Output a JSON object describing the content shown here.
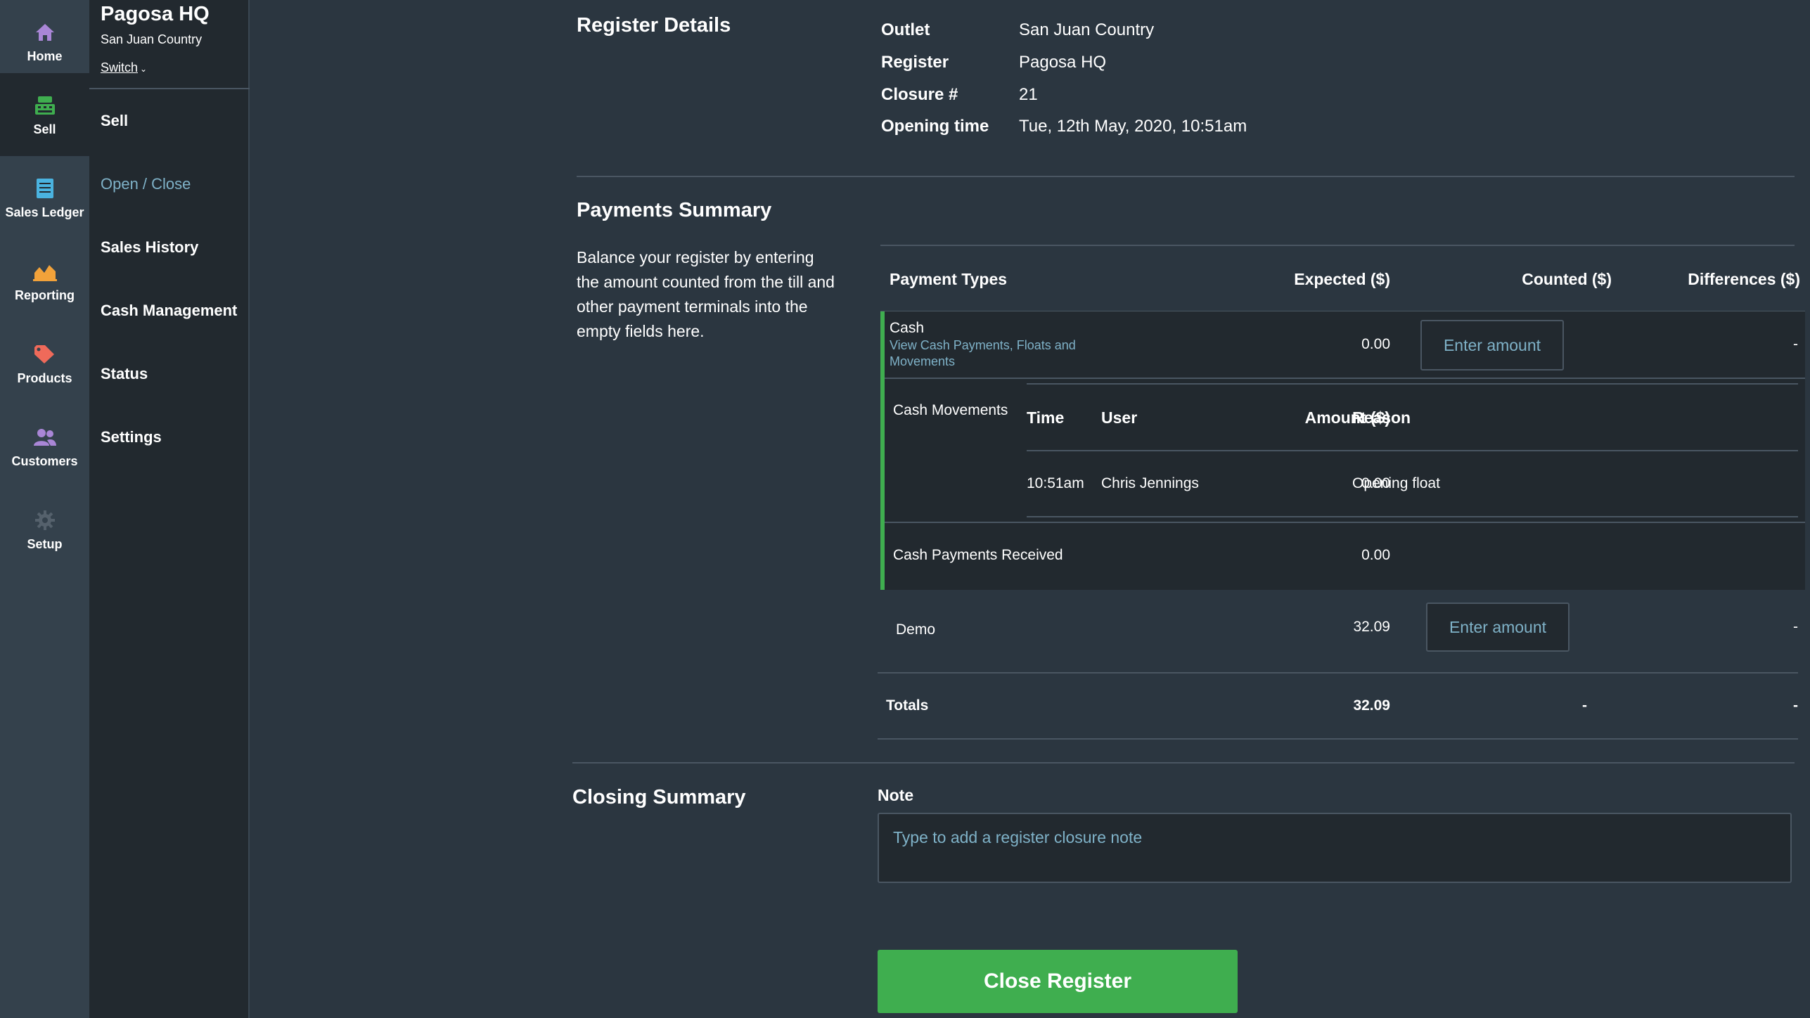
{
  "rail": [
    {
      "label": "Home",
      "icon": "home-icon",
      "color": "#a986d6"
    },
    {
      "label": "Sell",
      "icon": "register-icon",
      "color": "#3fae4f"
    },
    {
      "label": "Sales Ledger",
      "icon": "ledger-icon",
      "color": "#4ab3e0"
    },
    {
      "label": "Reporting",
      "icon": "chart-icon",
      "color": "#f2a23a"
    },
    {
      "label": "Products",
      "icon": "tag-icon",
      "color": "#ef6a5a"
    },
    {
      "label": "Customers",
      "icon": "users-icon",
      "color": "#a986d6"
    },
    {
      "label": "Setup",
      "icon": "gear-icon",
      "color": "#55616c"
    }
  ],
  "store": {
    "title": "Pagosa HQ",
    "subtitle": "San Juan Country",
    "switch_label": "Switch"
  },
  "subnav": [
    "Sell",
    "Open / Close",
    "Sales History",
    "Cash Management",
    "Status",
    "Settings"
  ],
  "register_details": {
    "heading": "Register Details",
    "rows": [
      {
        "key": "Outlet",
        "value": "San Juan Country"
      },
      {
        "key": "Register",
        "value": "Pagosa HQ"
      },
      {
        "key": "Closure #",
        "value": "21"
      },
      {
        "key": "Opening time",
        "value": "Tue, 12th May, 2020, 10:51am"
      }
    ]
  },
  "payments": {
    "heading": "Payments Summary",
    "description": "Balance your register by entering the amount counted from the till and other payment terminals into the empty fields here.",
    "columns": [
      "Payment Types",
      "Expected ($)",
      "Counted ($)",
      "Differences ($)"
    ],
    "cash": {
      "label": "Cash",
      "link": "View Cash Payments, Floats and Movements",
      "expected": "0.00",
      "placeholder": "Enter amount",
      "difference": "-"
    },
    "cash_movements": {
      "label": "Cash Movements",
      "columns": [
        "Time",
        "User",
        "Amount ($)",
        "Reason"
      ],
      "rows": [
        {
          "time": "10:51am",
          "user": "Chris Jennings",
          "amount": "0.00",
          "reason": "Opening float"
        }
      ]
    },
    "cash_payments_received": {
      "label": "Cash Payments Received",
      "value": "0.00"
    },
    "demo": {
      "label": "Demo",
      "expected": "32.09",
      "placeholder": "Enter amount",
      "difference": "-"
    },
    "totals": {
      "label": "Totals",
      "expected": "32.09",
      "counted": "-",
      "difference": "-"
    }
  },
  "closing": {
    "heading": "Closing Summary",
    "note_label": "Note",
    "note_placeholder": "Type to add a register closure note",
    "button": "Close Register"
  }
}
